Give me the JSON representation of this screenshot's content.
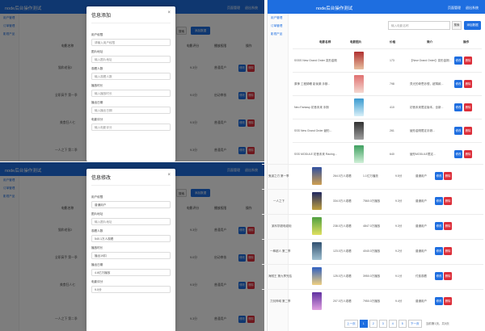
{
  "app": {
    "title": "node后台操作测试",
    "top_links": [
      "页面管理",
      "退出系统"
    ]
  },
  "sidebar": [
    "用户管理",
    "订单管理",
    "影视产品"
  ],
  "columns": [
    "电影名称",
    "电影图片",
    "价格",
    "简介",
    "操作"
  ],
  "modal_add": {
    "title": "信息添加",
    "close": "×",
    "fields": [
      {
        "label": "用户权限",
        "placeholder": "请输入用户权限"
      },
      {
        "label": "图片地址",
        "placeholder": "输入图片地址"
      },
      {
        "label": "观看人数",
        "placeholder": "输入观看人数"
      },
      {
        "label": "播放时长",
        "placeholder": "输入播放时长"
      },
      {
        "label": "播出日期",
        "placeholder": "输入播出日期"
      },
      {
        "label": "电影评分",
        "placeholder": "输入电影评分"
      }
    ]
  },
  "modal_edit": {
    "title": "信息修改",
    "close": "×",
    "fields": [
      {
        "label": "用户权限",
        "value": "普通用户"
      },
      {
        "label": "图片地址",
        "value": "输入图片地址"
      },
      {
        "label": "观看人数",
        "value": "540.1万人观看"
      },
      {
        "label": "播放时长",
        "value": "播出19扣"
      },
      {
        "label": "播出日期",
        "value": "4.6亿万播放"
      },
      {
        "label": "电影评分",
        "value": "9.0分"
      }
    ]
  },
  "bg_table": {
    "headers": [
      "播放量",
      "电影评分",
      "播放权限",
      "操作"
    ],
    "rows": [
      {
        "name": "猫和老鼠2",
        "score": "9.3分",
        "perm": "普通用户"
      },
      {
        "name": "全职高手 第一季",
        "score": "9.0分",
        "perm": "启动审核"
      },
      {
        "name": "美食狂人七",
        "score": "9.5分",
        "perm": "普通用户"
      },
      {
        "name": "一人之下 第二季",
        "score": "9.3分",
        "perm": "普通用户"
      }
    ]
  },
  "bg_edit_label": "修改",
  "bg_delete_label": "删除",
  "search": {
    "placeholder": "输入电影名称",
    "button": "搜索",
    "add": "添加数据"
  },
  "products": [
    {
      "name": "SSSS New Grand Order 变形金刚",
      "price": "173",
      "desc": "【New Grand Order】变形金刚...",
      "color": "#b03030"
    },
    {
      "name": "原神 工程師睡 影後樂 手辦...",
      "price": "798",
      "desc": "貝光的奇思妙想，超薄款...",
      "color": "#e07070"
    },
    {
      "name": "Neo Fantasy 初音未來 手辦",
      "price": "410",
      "desc": "初音未來限定版本，全新...",
      "color": "#3a9ad0"
    },
    {
      "name": "SSS New Grand Order 變形...",
      "price": "261",
      "desc": "變形金剛限定手辦...",
      "color": "#303030"
    },
    {
      "name": "SSS MODULE 初音未來 Racing...",
      "price": "640",
      "desc": "變形MODULE限定...",
      "color": "#40a060"
    }
  ],
  "movies": [
    {
      "name": "鬼滅之刃 第一季",
      "views": "264.0万人观看",
      "plays": "1.1亿万播放",
      "score": "9.5分",
      "perm": "普通用户",
      "color": "#3050a0"
    },
    {
      "name": "一人之下",
      "views": "334.0万人观看",
      "plays": "7560.0万播放",
      "score": "9.3分",
      "perm": "普通用户",
      "color": "#202860"
    },
    {
      "name": "某科学超电磁炮",
      "views": "238.0万人观看",
      "plays": "4847.0万播放",
      "score": "9.3分",
      "perm": "普通用户",
      "color": "#50a040"
    },
    {
      "name": "一拳超人 第二季",
      "views": "123.0万人观看",
      "plays": "4040.0万播放",
      "score": "9.2分",
      "perm": "普通用户",
      "color": "#305070"
    },
    {
      "name": "海贼王 第九季完结",
      "views": "125.0万人观看",
      "plays": "3950.0万播放",
      "score": "9.1分",
      "perm": "付费观看",
      "color": "#3060c0"
    },
    {
      "name": "刀剑神域 第二季",
      "views": "207.0万人观看",
      "plays": "7950.0万播放",
      "score": "9.4分",
      "perm": "普通用户",
      "color": "#6030a0"
    }
  ],
  "pagination": {
    "prev": "上一页",
    "pages": [
      "1",
      "2",
      "3",
      "4",
      "5"
    ],
    "next": "下一页",
    "info": "当前第1页，共5页"
  }
}
